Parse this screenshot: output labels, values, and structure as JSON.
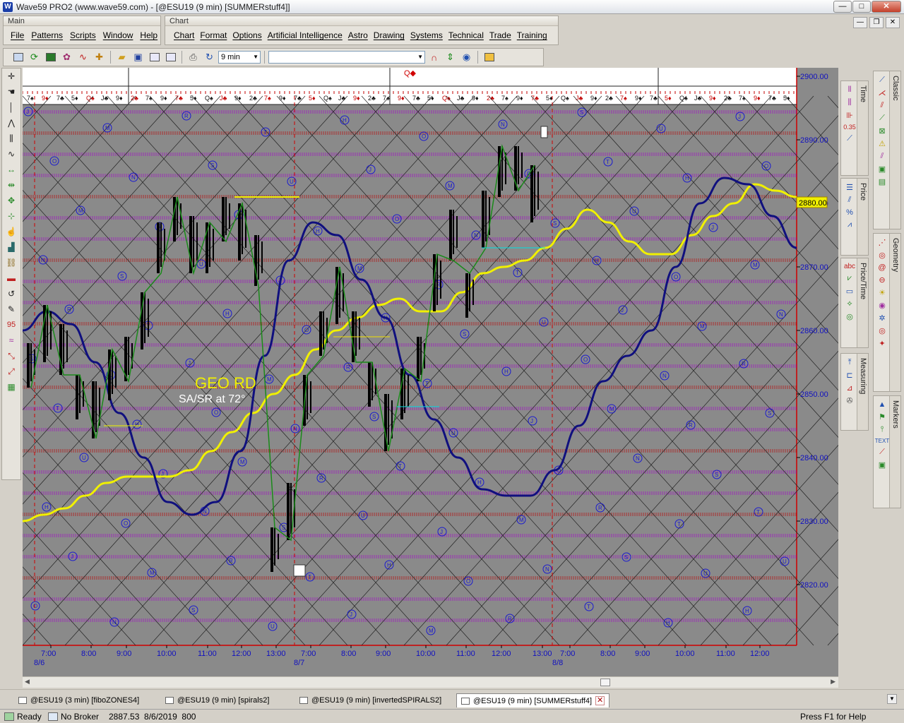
{
  "window": {
    "title": "Wave59 PRO2 (www.wave59.com) - [@ESU19 (9 min) [SUMMERstuff4]]",
    "app_icon_letter": "W",
    "minimize": "—",
    "maximize": "□",
    "close": "✕"
  },
  "menu_groups": {
    "main": {
      "label": "Main",
      "items": [
        "File",
        "Patterns",
        "Scripts",
        "Window",
        "Help"
      ]
    },
    "chart": {
      "label": "Chart",
      "items": [
        "Chart",
        "Format",
        "Options",
        "Artificial Intelligence",
        "Astro",
        "Drawing",
        "Systems",
        "Technical",
        "Trade",
        "Training"
      ]
    }
  },
  "mdi_controls": [
    "—",
    "❐",
    "✕"
  ],
  "toolbar": {
    "interval_value": "9 min",
    "symbol_value": ""
  },
  "chart": {
    "top_marker": "Q◆",
    "annotation_title": "GEO RD",
    "annotation_sub": "SA/SR at 72°",
    "price_flag": "2880.00",
    "colors": {
      "background": "#8a8a8a",
      "ma_line": "#f0f000",
      "cycle_line": "#10107e",
      "swing_line": "#1a8a1a",
      "axis_text": "#1010c0"
    }
  },
  "chart_data": {
    "type": "line",
    "title": "",
    "xlabel": "",
    "ylabel": "",
    "ylim": [
      2813,
      2902
    ],
    "y_ticks": [
      "2900.00",
      "2890.00",
      "2880.00",
      "2870.00",
      "2860.00",
      "2850.00",
      "2840.00",
      "2830.00",
      "2820.00"
    ],
    "y_tick_values": [
      2900,
      2890,
      2880,
      2870,
      2860,
      2850,
      2840,
      2830,
      2820
    ],
    "x_ticks": [
      "7:00",
      "8:00",
      "9:00",
      "10:00",
      "11:00",
      "12:00",
      "13:00",
      "7:00",
      "8:00",
      "9:00",
      "10:00",
      "11:00",
      "12:00",
      "13:00",
      "7:00",
      "8:00",
      "9:00",
      "10:00",
      "11:00",
      "12:00"
    ],
    "date_labels": [
      "8/6",
      "8/7",
      "8/8"
    ],
    "series": [
      {
        "values": [
          2830,
          2831,
          2832,
          2834,
          2836,
          2837,
          2837,
          2837,
          2838,
          2841,
          2844,
          2847,
          2850,
          2853,
          2857,
          2860,
          2862,
          2864,
          2865,
          2863,
          2863,
          2866,
          2869,
          2870,
          2871,
          2873,
          2876,
          2879,
          2877,
          2874,
          2872,
          2872,
          2875,
          2878,
          2880,
          2883,
          2882,
          2881
        ]
      },
      {
        "values": [
          2860,
          2863,
          2861,
          2855,
          2847,
          2840,
          2833,
          2831,
          2833,
          2841,
          2856,
          2871,
          2877,
          2875,
          2868,
          2862,
          2853,
          2846,
          2840,
          2835,
          2834,
          2834,
          2838,
          2845,
          2852,
          2856,
          2860,
          2870,
          2880,
          2884,
          2883,
          2878,
          2873
        ]
      }
    ]
  },
  "status": {
    "ready": "Ready",
    "broker": "No Broker",
    "quote": "2887.53  8/6/2019  800",
    "help": "Press F1 for Help"
  },
  "tabs": [
    {
      "label": "@ESU19 (3 min) [fiboZONES4]"
    },
    {
      "label": "@ESU19 (9 min) [spirals2]"
    },
    {
      "label": "@ESU19 (9 min) [invertedSPIRALS2]"
    },
    {
      "label": "@ESU19 (9 min) [SUMMERstuff4]"
    }
  ],
  "right_tabs": [
    "Time",
    "Price",
    "Price/Time",
    "Measuring",
    "Classic",
    "Geometry",
    "Markers"
  ],
  "right_icon_text": {
    "fib": "0.35",
    "pct": "%",
    "abc": "abc",
    "text": "TEXT"
  },
  "left_tool_labels": {
    "n95": "95"
  }
}
